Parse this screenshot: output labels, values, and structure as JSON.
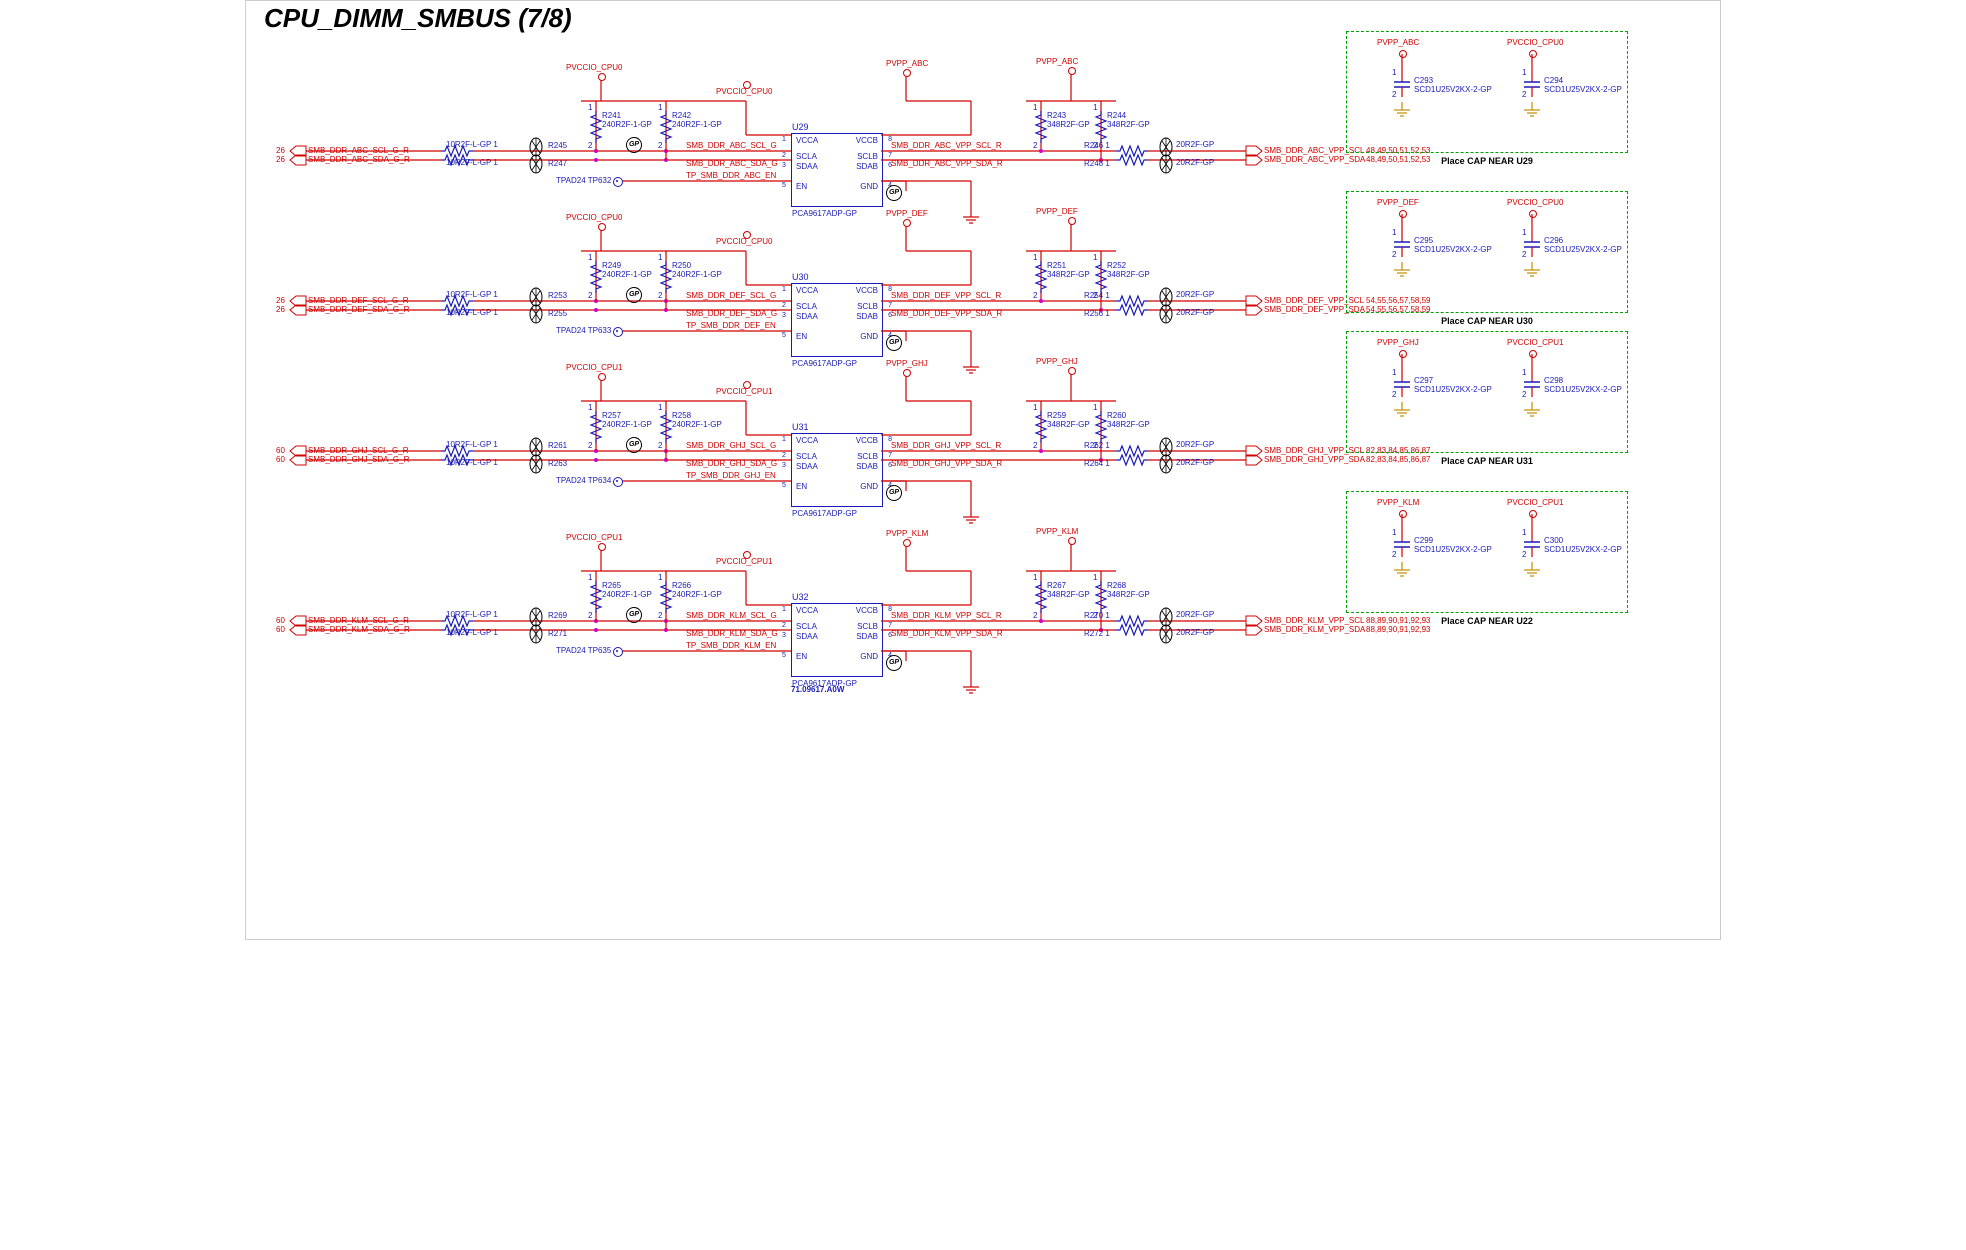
{
  "title": "CPU_DIMM_SMBUS (7/8)",
  "channels": [
    {
      "suffix": "ABC",
      "u": "U29",
      "tp": "TP632",
      "part": "PCA9617ADP-GP",
      "vccio": "PVCCIO_CPU0",
      "pvpp": "PVPP_ABC",
      "rL1": "R245",
      "rL2": "R247",
      "rPU1": "R241",
      "rPU2": "R242",
      "rPU1v": "240R2F-1-GP",
      "rPU2v": "240R2F-1-GP",
      "rPU3": "R243",
      "rPU4": "R244",
      "rPU3v": "348R2F-GP",
      "rPU4v": "348R2F-GP",
      "rR1": "R246",
      "rR2": "R248",
      "rRR1": "20R2F-GP",
      "rRR2": "20R2F-GP",
      "netLscl": "SMB_DDR_ABC_SCL_G_R",
      "netLsda": "SMB_DDR_ABC_SDA_G_R",
      "pgL": "26",
      "netEn": "TP_SMB_DDR_ABC_EN",
      "tpad": "TPAD24",
      "netMidScl": "SMB_DDR_ABC_SCL_G",
      "netMidSda": "SMB_DDR_ABC_SDA_G",
      "netRscl": "SMB_DDR_ABC_VPP_SCL_R",
      "netRsda": "SMB_DDR_ABC_VPP_SDA_R",
      "netOutScl": "SMB_DDR_ABC_VPP_SCL",
      "netOutSda": "SMB_DDR_ABC_VPP_SDA",
      "pgR": "48,49,50,51,52,53",
      "rLval": "10R2F-L-GP"
    },
    {
      "suffix": "DEF",
      "u": "U30",
      "tp": "TP633",
      "part": "PCA9617ADP-GP",
      "vccio": "PVCCIO_CPU0",
      "pvpp": "PVPP_DEF",
      "rL1": "R253",
      "rL2": "R255",
      "rPU1": "R249",
      "rPU2": "R250",
      "rPU1v": "240R2F-1-GP",
      "rPU2v": "240R2F-1-GP",
      "rPU3": "R251",
      "rPU4": "R252",
      "rPU3v": "348R2F-GP",
      "rPU4v": "348R2F-GP",
      "rR1": "R254",
      "rR2": "R256",
      "rRR1": "20R2F-GP",
      "rRR2": "20R2F-GP",
      "netLscl": "SMB_DDR_DEF_SCL_G_R",
      "netLsda": "SMB_DDR_DEF_SDA_G_R",
      "pgL": "26",
      "netEn": "TP_SMB_DDR_DEF_EN",
      "tpad": "TPAD24",
      "netMidScl": "SMB_DDR_DEF_SCL_G",
      "netMidSda": "SMB_DDR_DEF_SDA_G",
      "netRscl": "SMB_DDR_DEF_VPP_SCL_R",
      "netRsda": "SMB_DDR_DEF_VPP_SDA_R",
      "netOutScl": "SMB_DDR_DEF_VPP_SCL",
      "netOutSda": "SMB_DDR_DEF_VPP_SDA",
      "pgR": "54,55,56,57,58,59",
      "rLval": "10R2F-L-GP"
    },
    {
      "suffix": "GHJ",
      "u": "U31",
      "tp": "TP634",
      "part": "PCA9617ADP-GP",
      "vccio": "PVCCIO_CPU1",
      "pvpp": "PVPP_GHJ",
      "rL1": "R261",
      "rL2": "R263",
      "rPU1": "R257",
      "rPU2": "R258",
      "rPU1v": "240R2F-1-GP",
      "rPU2v": "240R2F-1-GP",
      "rPU3": "R259",
      "rPU4": "R260",
      "rPU3v": "348R2F-GP",
      "rPU4v": "348R2F-GP",
      "rR1": "R262",
      "rR2": "R264",
      "rRR1": "20R2F-GP",
      "rRR2": "20R2F-GP",
      "netLscl": "SMB_DDR_GHJ_SCL_G_R",
      "netLsda": "SMB_DDR_GHJ_SDA_G_R",
      "pgL": "60",
      "netEn": "TP_SMB_DDR_GHJ_EN",
      "tpad": "TPAD24",
      "netMidScl": "SMB_DDR_GHJ_SCL_G",
      "netMidSda": "SMB_DDR_GHJ_SDA_G",
      "netRscl": "SMB_DDR_GHJ_VPP_SCL_R",
      "netRsda": "SMB_DDR_GHJ_VPP_SDA_R",
      "netOutScl": "SMB_DDR_GHJ_VPP_SCL",
      "netOutSda": "SMB_DDR_GHJ_VPP_SDA",
      "pgR": "82,83,84,85,86,87",
      "rLval": "10R2F-L-GP"
    },
    {
      "suffix": "KLM",
      "u": "U32",
      "tp": "TP635",
      "part": "PCA9617ADP-GP",
      "vccio": "PVCCIO_CPU1",
      "pvpp": "PVPP_KLM",
      "rL1": "R269",
      "rL2": "R271",
      "rPU1": "R265",
      "rPU2": "R266",
      "rPU1v": "240R2F-1-GP",
      "rPU2v": "240R2F-1-GP",
      "rPU3": "R267",
      "rPU4": "R268",
      "rPU3v": "348R2F-GP",
      "rPU4v": "348R2F-GP",
      "rR1": "R270",
      "rR2": "R272",
      "rRR1": "20R2F-GP",
      "rRR2": "20R2F-GP",
      "netLscl": "SMB_DDR_KLM_SCL_G_R",
      "netLsda": "SMB_DDR_KLM_SDA_G_R",
      "pgL": "60",
      "netEn": "TP_SMB_DDR_KLM_EN",
      "tpad": "TPAD24",
      "netMidScl": "SMB_DDR_KLM_SCL_G",
      "netMidSda": "SMB_DDR_KLM_SDA_G",
      "netRscl": "SMB_DDR_KLM_VPP_SCL_R",
      "netRsda": "SMB_DDR_KLM_VPP_SDA_R",
      "netOutScl": "SMB_DDR_KLM_VPP_SCL",
      "netOutSda": "SMB_DDR_KLM_VPP_SDA",
      "pgR": "88,89,90,91,92,93",
      "rLval": "10R2F-L-GP",
      "extraPart": "71.09617.A0W"
    }
  ],
  "capBoxes": [
    {
      "label": "Place CAP NEAR U29",
      "pwr1": "PVPP_ABC",
      "pwr2": "PVCCIO_CPU0",
      "c1": "C293",
      "c2": "C294",
      "cval": "SCD1U25V2KX-2-GP"
    },
    {
      "label": "Place CAP NEAR U30",
      "pwr1": "PVPP_DEF",
      "pwr2": "PVCCIO_CPU0",
      "c1": "C295",
      "c2": "C296",
      "cval": "SCD1U25V2KX-2-GP"
    },
    {
      "label": "Place CAP NEAR U31",
      "pwr1": "PVPP_GHJ",
      "pwr2": "PVCCIO_CPU1",
      "c1": "C297",
      "c2": "C298",
      "cval": "SCD1U25V2KX-2-GP"
    },
    {
      "label": "Place CAP NEAR U22",
      "pwr1": "PVPP_KLM",
      "pwr2": "PVCCIO_CPU1",
      "c1": "C299",
      "c2": "C300",
      "cval": "SCD1U25V2KX-2-GP"
    }
  ],
  "icPins": {
    "p1": "VCCA",
    "p2": "SCLA",
    "p3": "SDAA",
    "p5": "EN",
    "p8": "VCCB",
    "p7": "SCLB",
    "p6": "SDAB",
    "p4": "GND"
  },
  "pinNums": {
    "p1": "1",
    "p2": "2",
    "p3": "3",
    "p5": "5",
    "p8": "8",
    "p7": "7",
    "p6": "6",
    "p4": "4"
  }
}
